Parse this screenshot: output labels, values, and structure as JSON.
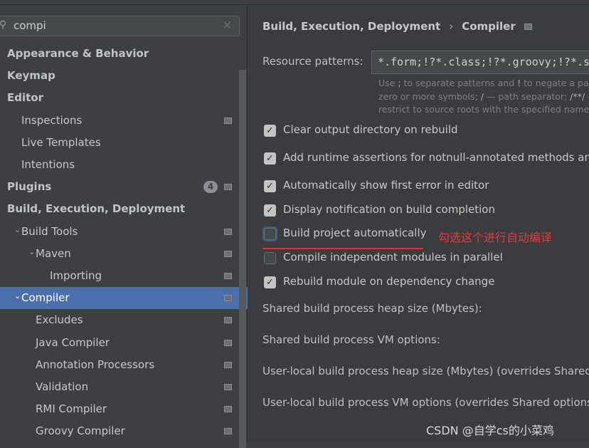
{
  "search": {
    "value": "compi"
  },
  "tree": [
    {
      "label": "Appearance & Behavior",
      "bold": true,
      "indent": 0
    },
    {
      "label": "Keymap",
      "bold": true,
      "indent": 0
    },
    {
      "label": "Editor",
      "bold": true,
      "indent": 0,
      "arrow": "down"
    },
    {
      "label": "Inspections",
      "indent": 1,
      "mark": true
    },
    {
      "label": "Live Templates",
      "indent": 1
    },
    {
      "label": "Intentions",
      "indent": 1
    },
    {
      "label": "Plugins",
      "bold": true,
      "indent": 0,
      "badge": "4",
      "mark": true
    },
    {
      "label": "Build, Execution, Deployment",
      "bold": true,
      "indent": 0,
      "arrow": "down"
    },
    {
      "label": "Build Tools",
      "indent": 1,
      "arrow": "down",
      "mark": true
    },
    {
      "label": "Maven",
      "indent": 2,
      "arrow": "down",
      "mark": true
    },
    {
      "label": "Importing",
      "indent": 3,
      "mark": true
    },
    {
      "label": "Compiler",
      "indent": 1,
      "arrow": "down",
      "mark": true,
      "selected": true
    },
    {
      "label": "Excludes",
      "indent": 2,
      "mark": true
    },
    {
      "label": "Java Compiler",
      "indent": 2,
      "mark": true
    },
    {
      "label": "Annotation Processors",
      "indent": 2,
      "mark": true
    },
    {
      "label": "Validation",
      "indent": 2,
      "mark": true
    },
    {
      "label": "RMI Compiler",
      "indent": 2,
      "mark": true
    },
    {
      "label": "Groovy Compiler",
      "indent": 2,
      "mark": true
    }
  ],
  "breadcrumb": {
    "parent": "Build, Execution, Deployment",
    "current": "Compiler"
  },
  "resource": {
    "label": "Resource patterns:",
    "value": "*.form;!?*.class;!?*.groovy;!?*.scala",
    "hint1a": "Use ",
    "hint1b": ";",
    "hint1c": " to separate patterns and ",
    "hint1d": "!",
    "hint1e": " to negate a patt",
    "hint2a": "zero or more symbols; ",
    "hint2b": "/",
    "hint2c": " — path separator; ",
    "hint2d": "/**/",
    "hint2e": " -",
    "hint3": "restrict to source roots with the specified name"
  },
  "options": [
    {
      "label": "Clear output directory on rebuild",
      "checked": true
    },
    {
      "label": "Add runtime assertions for notnull-annotated methods and",
      "checked": true
    },
    {
      "label": "Automatically show first error in editor",
      "checked": true
    },
    {
      "label": "Display notification on build completion",
      "checked": true
    },
    {
      "label": "Build project automatically",
      "checked": false
    },
    {
      "label": "Compile independent modules in parallel",
      "checked": false
    },
    {
      "label": "Rebuild module on dependency change",
      "checked": true
    }
  ],
  "fields": [
    "Shared build process heap size (Mbytes):",
    "Shared build process VM options:",
    "User-local build process heap size (Mbytes) (overrides Shared s",
    "User-local build process VM options (overrides Shared options)"
  ],
  "annotation": "勾选这个进行自动编译",
  "watermark": "CSDN @自学cs的小菜鸡",
  "colors": {
    "selection": "#4b6eaf",
    "annotation": "#e03030"
  }
}
